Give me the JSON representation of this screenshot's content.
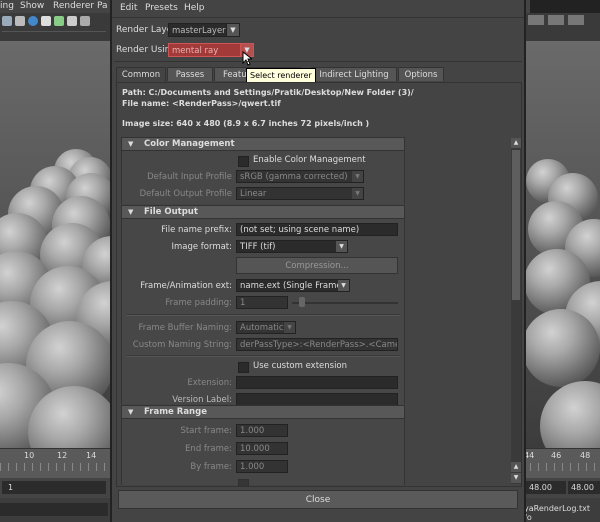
{
  "background": {
    "menu": [
      "ing",
      "Show",
      "Renderer",
      "Pa"
    ],
    "timeline_ticks_left": [
      "10",
      "12",
      "14"
    ],
    "timeline_ticks_right": [
      "44",
      "46",
      "48"
    ],
    "range_left": "1",
    "range_right_a": "48.00",
    "range_right_b": "48.00",
    "cmd_line_left": "1",
    "cmd_line_right": "yaRenderLog.txt fo"
  },
  "dialog": {
    "menu": [
      "Edit",
      "Presets",
      "Help"
    ],
    "render_layer_label": "Render Layer",
    "render_layer_value": "masterLayer",
    "render_using_label": "Render Using",
    "render_using_value": "mental ray",
    "tooltip": "Select renderer",
    "tabs": [
      "Common",
      "Passes",
      "Featu",
      "Indirect Lighting",
      "Options"
    ],
    "path_line": "Path: C:/Documents and Settings/Pratik/Desktop/New Folder (3)/",
    "file_name_line": "File name:  <RenderPass>/qwert.tif",
    "image_size_line": "Image size: 640 x 480 (8.9 x 6.7 inches 72 pixels/inch )",
    "color_mgmt": {
      "title": "Color Management",
      "enable_label": "Enable Color Management",
      "input_profile_label": "Default Input Profile",
      "input_profile_value": "sRGB (gamma corrected)",
      "output_profile_label": "Default Output Profile",
      "output_profile_value": "Linear"
    },
    "file_output": {
      "title": "File Output",
      "prefix_label": "File name prefix:",
      "prefix_value": "(not set; using scene name)",
      "format_label": "Image format:",
      "format_value": "TIFF (tif)",
      "compression_label": "Compression...",
      "ext_label": "Frame/Animation ext:",
      "ext_value": "name.ext (Single Frame)",
      "padding_label": "Frame padding:",
      "padding_value": "1",
      "buffer_label": "Frame Buffer Naming:",
      "buffer_value": "Automatic",
      "custom_label": "Custom Naming String:",
      "custom_value": "derPassType>:<RenderPass>.<Camera>",
      "use_custom_ext_label": "Use custom extension",
      "extension_label": "Extension:",
      "extension_value": "",
      "version_label": "Version Label:",
      "version_value": ""
    },
    "frame_range": {
      "title": "Frame Range",
      "start_label": "Start frame:",
      "start_value": "1.000",
      "end_label": "End frame:",
      "end_value": "10.000",
      "by_label": "By frame:",
      "by_value": "1.000"
    },
    "close_label": "Close"
  },
  "colors": {
    "selected_renderer_bg": "#a33a3a",
    "tooltip_bg": "#ffffdc"
  }
}
